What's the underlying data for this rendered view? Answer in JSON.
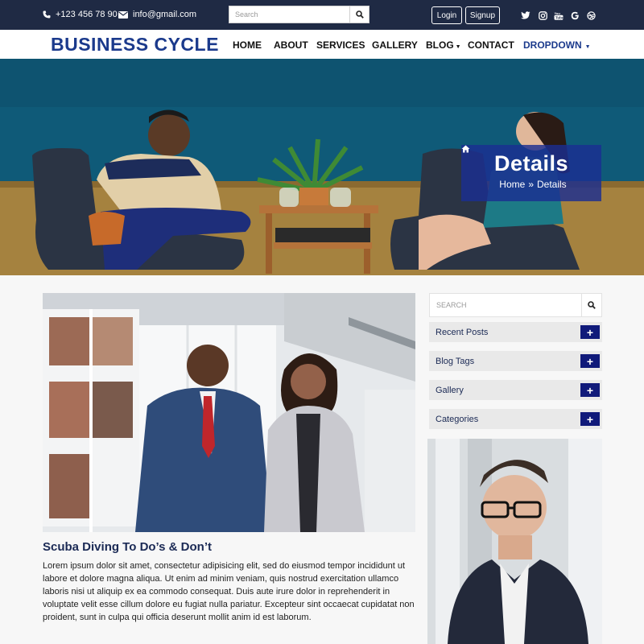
{
  "topbar": {
    "phone": "+123 456 78 90",
    "email": "info@gmail.com",
    "search_placeholder": "Search",
    "login_label": "Login",
    "signup_label": "Signup",
    "social_icons": [
      "twitter-icon",
      "instagram-icon",
      "youtube-icon",
      "google-icon",
      "dribbble-icon"
    ]
  },
  "nav": {
    "brand": "BUSINESS CYCLE",
    "items": [
      "HOME",
      "ABOUT",
      "SERVICES",
      "GALLERY",
      "BLOG",
      "CONTACT",
      "DROPDOWN"
    ]
  },
  "hero": {
    "title": "Details",
    "breadcrumb_home": "Home",
    "breadcrumb_current": "Details"
  },
  "post": {
    "title": "Scuba Diving To Do’s & Don’t",
    "body": "Lorem ipsum dolor sit amet, consectetur adipisicing elit, sed do eiusmod tempor incididunt ut labore et dolore magna aliqua. Ut enim ad minim veniam, quis nostrud exercitation ullamco laboris nisi ut aliquip ex ea commodo consequat. Duis aute irure dolor in reprehenderit in voluptate velit esse cillum dolore eu fugiat nulla pariatur. Excepteur sint occaecat cupidatat non proident, sunt in culpa qui officia deserunt mollit anim id est laborum."
  },
  "sidebar": {
    "search_placeholder": "SEARCH",
    "sections": [
      "Recent Posts",
      "Blog Tags",
      "Gallery",
      "Categories"
    ]
  },
  "colors": {
    "topbar_bg": "#1f2a44",
    "brand": "#1b3a8c",
    "accent_button": "#101a7a",
    "hero_overlay": "#1b2e91"
  }
}
